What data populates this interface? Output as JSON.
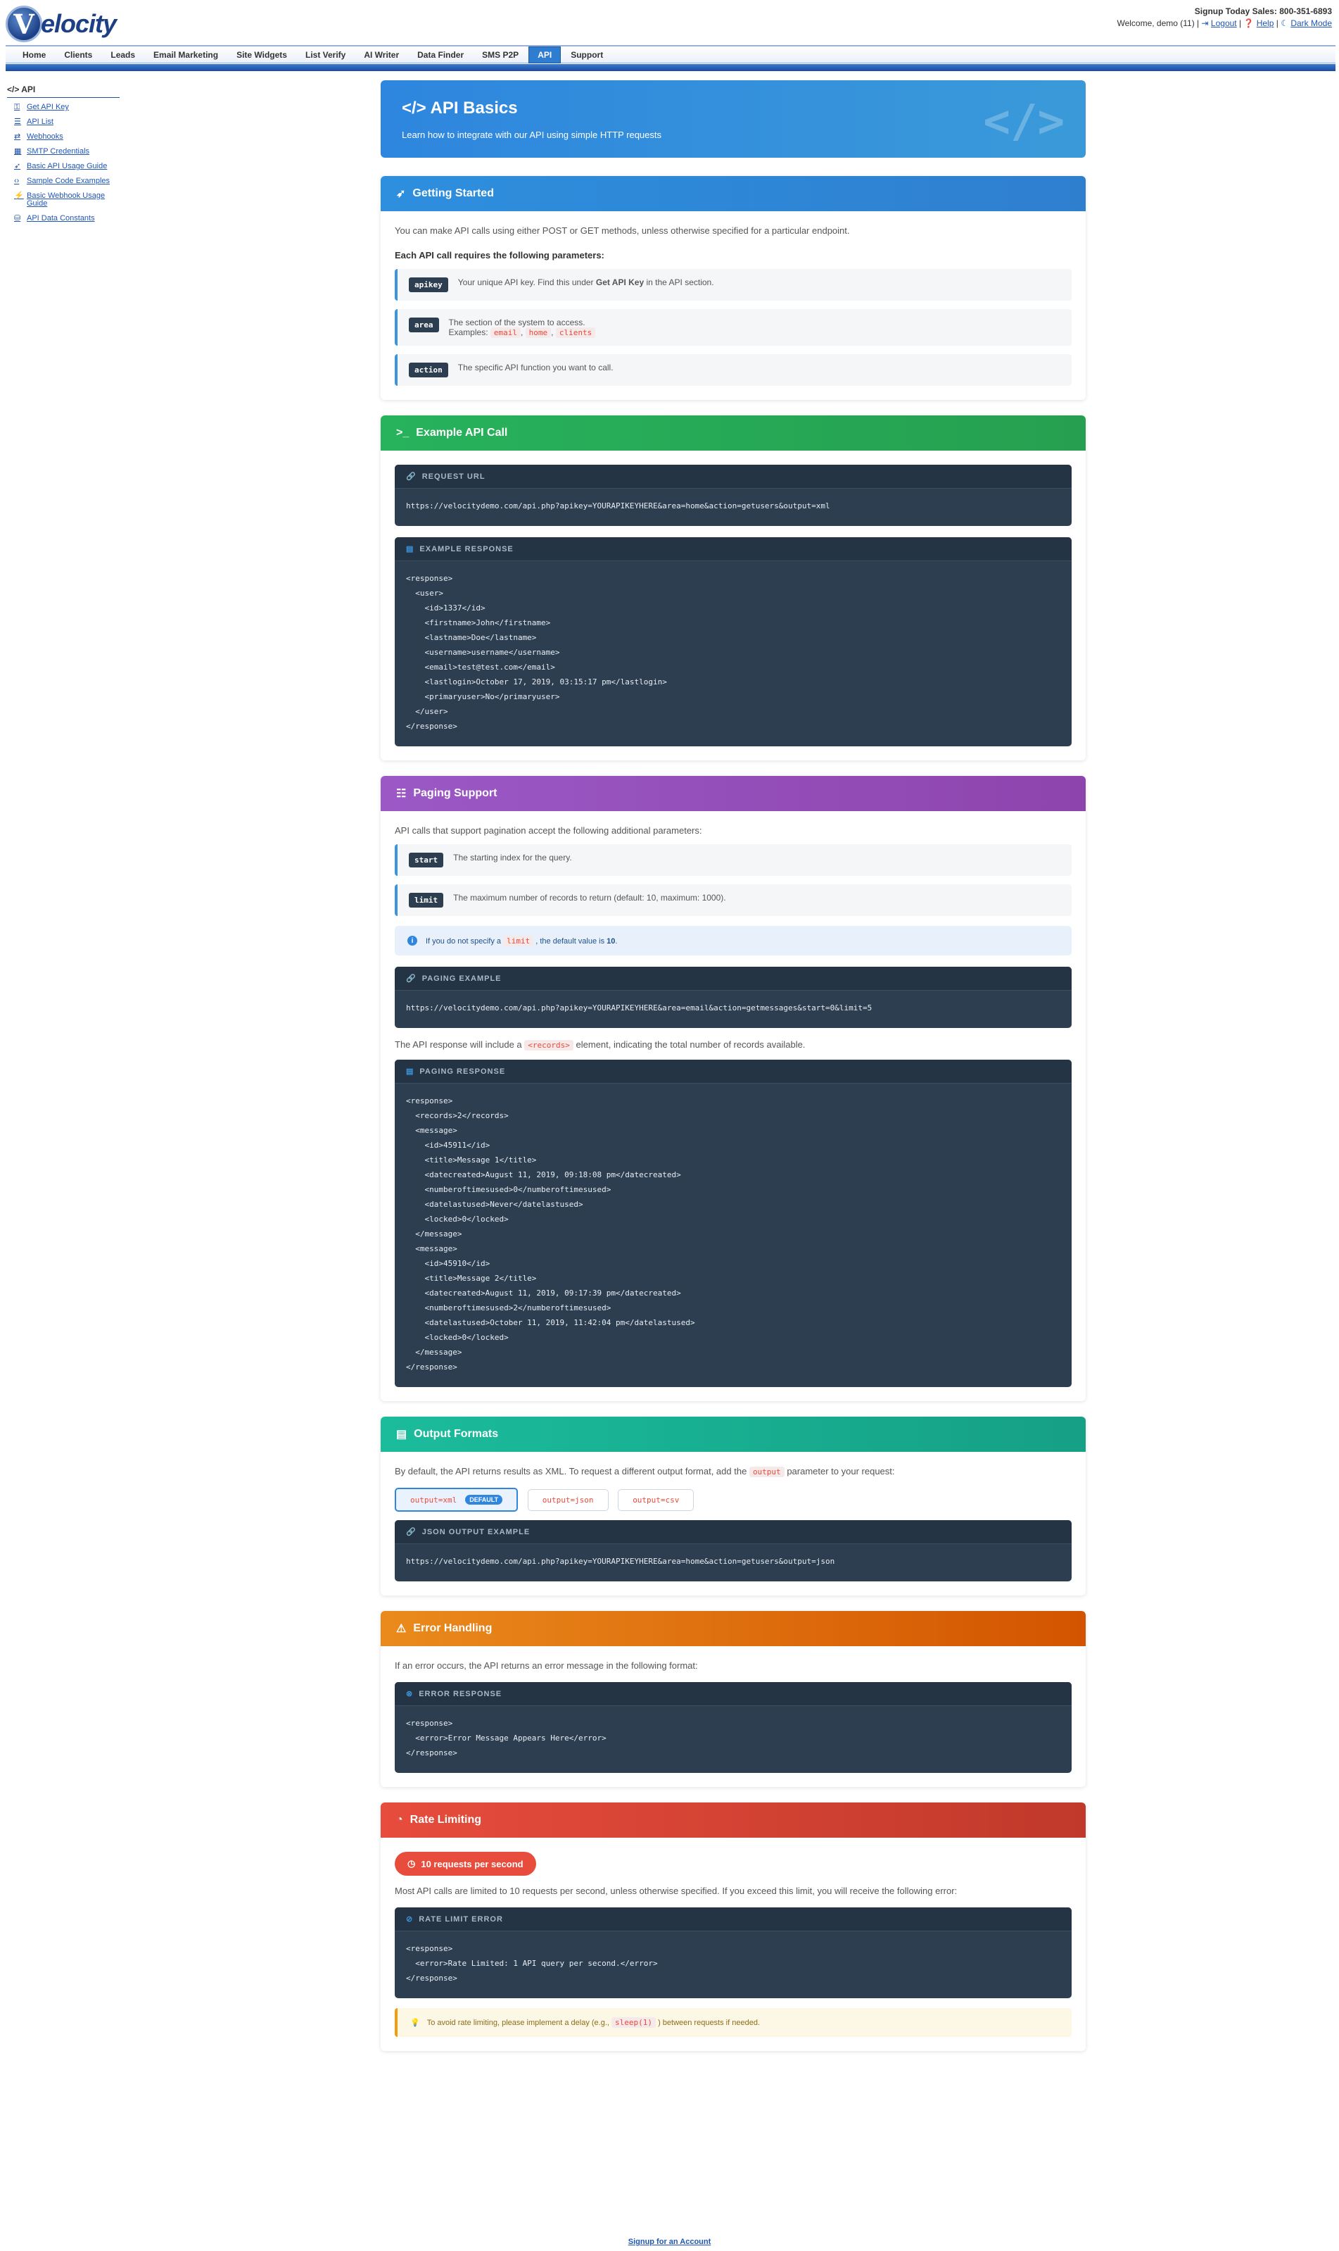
{
  "header": {
    "logo_text": "elocity",
    "logo_letter": "V",
    "sales_text": "Signup Today Sales: 800-351-6893",
    "welcome_text": "Welcome, demo (11) |",
    "logout_label": "Logout",
    "help_label": "Help",
    "darkmode_label": "Dark Mode"
  },
  "nav": {
    "items": [
      "Home",
      "Clients",
      "Leads",
      "Email Marketing",
      "Site Widgets",
      "List Verify",
      "AI Writer",
      "Data Finder",
      "SMS P2P",
      "API",
      "Support"
    ],
    "active": "API"
  },
  "sidebar": {
    "title": "API",
    "items": [
      {
        "icon": "key-icon",
        "label": "Get API Key"
      },
      {
        "icon": "list-icon",
        "label": "API List"
      },
      {
        "icon": "exchange-icon",
        "label": "Webhooks"
      },
      {
        "icon": "grid-icon",
        "label": "SMTP Credentials"
      },
      {
        "icon": "rocket-icon",
        "label": "Basic API Usage Guide"
      },
      {
        "icon": "code-icon",
        "label": "Sample Code Examples"
      },
      {
        "icon": "plug-icon",
        "label": "Basic Webhook Usage Guide"
      },
      {
        "icon": "database-icon",
        "label": "API Data Constants"
      }
    ]
  },
  "hero": {
    "title": "API Basics",
    "subtitle": "Learn how to integrate with our API using simple HTTP requests"
  },
  "getting_started": {
    "title": "Getting Started",
    "intro": "You can make API calls using either POST or GET methods, unless otherwise specified for a particular endpoint.",
    "params_heading": "Each API call requires the following parameters:",
    "apikey_tag": "apikey",
    "apikey_desc": "Your unique API key. Find this under",
    "apikey_bold": "Get API Key",
    "apikey_desc2": "in the API section.",
    "area_tag": "area",
    "area_desc": "The section of the system to access.",
    "area_examples_label": "Examples:",
    "area_examples": [
      "email",
      "home",
      "clients"
    ],
    "action_tag": "action",
    "action_desc": "The specific API function you want to call."
  },
  "example_call": {
    "title": "Example API Call",
    "request_label": "REQUEST URL",
    "request_url": "https://velocitydemo.com/api.php?apikey=YOURAPIKEYHERE&area=home&action=getusers&output=xml",
    "response_label": "EXAMPLE RESPONSE",
    "response_code": "<response>\n  <user>\n    <id>1337</id>\n    <firstname>John</firstname>\n    <lastname>Doe</lastname>\n    <username>username</username>\n    <email>test@test.com</email>\n    <lastlogin>October 17, 2019, 03:15:17 pm</lastlogin>\n    <primaryuser>No</primaryuser>\n  </user>\n</response>"
  },
  "paging": {
    "title": "Paging Support",
    "intro": "API calls that support pagination accept the following additional parameters:",
    "start_tag": "start",
    "start_desc": "The starting index for the query.",
    "limit_tag": "limit",
    "limit_desc": "The maximum number of records to return (default: 10, maximum: 1000).",
    "info_pre": "If you do not specify a",
    "info_code": "limit",
    "info_post": ", the default value is",
    "info_value": "10",
    "example_label": "PAGING EXAMPLE",
    "example_url": "https://velocitydemo.com/api.php?apikey=YOURAPIKEYHERE&area=email&action=getmessages&start=0&limit=5",
    "note_pre": "The API response will include a",
    "note_code": "<records>",
    "note_post": "element, indicating the total number of records available.",
    "response_label": "PAGING RESPONSE",
    "response_code": "<response>\n  <records>2</records>\n  <message>\n    <id>45911</id>\n    <title>Message 1</title>\n    <datecreated>August 11, 2019, 09:18:08 pm</datecreated>\n    <numberoftimesused>0</numberoftimesused>\n    <datelastused>Never</datelastused>\n    <locked>0</locked>\n  </message>\n  <message>\n    <id>45910</id>\n    <title>Message 2</title>\n    <datecreated>August 11, 2019, 09:17:39 pm</datecreated>\n    <numberoftimesused>2</numberoftimesused>\n    <datelastused>October 11, 2019, 11:42:04 pm</datelastused>\n    <locked>0</locked>\n  </message>\n</response>"
  },
  "output": {
    "title": "Output Formats",
    "intro_pre": "By default, the API returns results as XML. To request a different output format, add the",
    "intro_code": "output",
    "intro_post": "parameter to your request:",
    "formats": [
      "output=xml",
      "output=json",
      "output=csv"
    ],
    "default_badge": "DEFAULT",
    "json_label": "JSON OUTPUT EXAMPLE",
    "json_url": "https://velocitydemo.com/api.php?apikey=YOURAPIKEYHERE&area=home&action=getusers&output=json"
  },
  "errors": {
    "title": "Error Handling",
    "intro": "If an error occurs, the API returns an error message in the following format:",
    "label": "ERROR RESPONSE",
    "code": "<response>\n  <error>Error Message Appears Here</error>\n</response>"
  },
  "rate": {
    "title": "Rate Limiting",
    "badge": "10 requests per second",
    "intro": "Most API calls are limited to 10 requests per second, unless otherwise specified. If you exceed this limit, you will receive the following error:",
    "label": "RATE LIMIT ERROR",
    "code": "<response>\n  <error>Rate Limited: 1 API query per second.</error>\n</response>",
    "tip_pre": "To avoid rate limiting, please implement a delay (e.g.,",
    "tip_code": "sleep(1)",
    "tip_post": ") between requests if needed."
  },
  "footer": {
    "signup_label": "Signup for an Account"
  }
}
